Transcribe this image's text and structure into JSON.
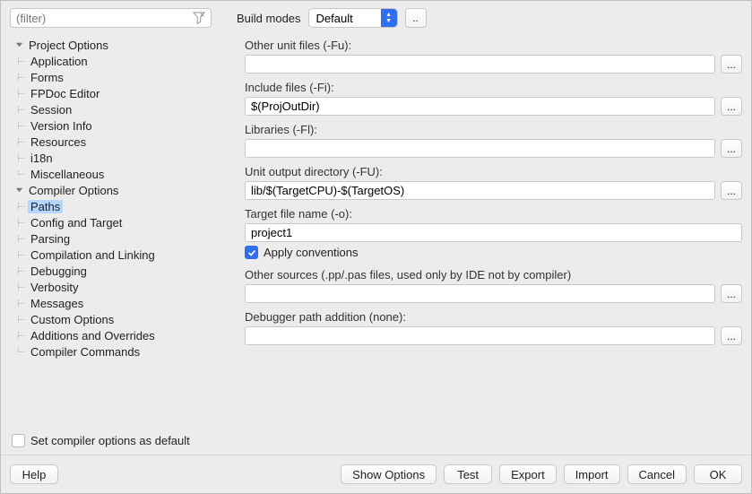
{
  "filter": {
    "placeholder": "(filter)"
  },
  "build_modes": {
    "label": "Build modes",
    "selected": "Default",
    "more": ".."
  },
  "tree": {
    "project_options": {
      "label": "Project Options",
      "children": [
        "Application",
        "Forms",
        "FPDoc Editor",
        "Session",
        "Version Info",
        "Resources",
        "i18n",
        "Miscellaneous"
      ]
    },
    "compiler_options": {
      "label": "Compiler Options",
      "children": [
        "Paths",
        "Config and Target",
        "Parsing",
        "Compilation and Linking",
        "Debugging",
        "Verbosity",
        "Messages",
        "Custom Options",
        "Additions and Overrides",
        "Compiler Commands"
      ],
      "selected_index": 0
    }
  },
  "fields": {
    "other_unit_files": {
      "label": "Other unit files (-Fu):",
      "value": ""
    },
    "include_files": {
      "label": "Include files (-Fi):",
      "value": "$(ProjOutDir)"
    },
    "libraries": {
      "label": "Libraries (-Fl):",
      "value": ""
    },
    "unit_output": {
      "label": "Unit output directory (-FU):",
      "value": "lib/$(TargetCPU)-$(TargetOS)"
    },
    "target_file": {
      "label": "Target file name (-o):",
      "value": "project1"
    },
    "apply_conventions": {
      "label": "Apply conventions",
      "checked": true
    },
    "other_sources": {
      "label": "Other sources (.pp/.pas files, used only by IDE not by compiler)",
      "value": ""
    },
    "debugger_path": {
      "label": "Debugger path addition (none):",
      "value": ""
    }
  },
  "set_default": {
    "label": "Set compiler options as default",
    "checked": false
  },
  "buttons": {
    "help": "Help",
    "show_options": "Show Options",
    "test": "Test",
    "export": "Export",
    "import": "Import",
    "cancel": "Cancel",
    "ok": "OK"
  }
}
